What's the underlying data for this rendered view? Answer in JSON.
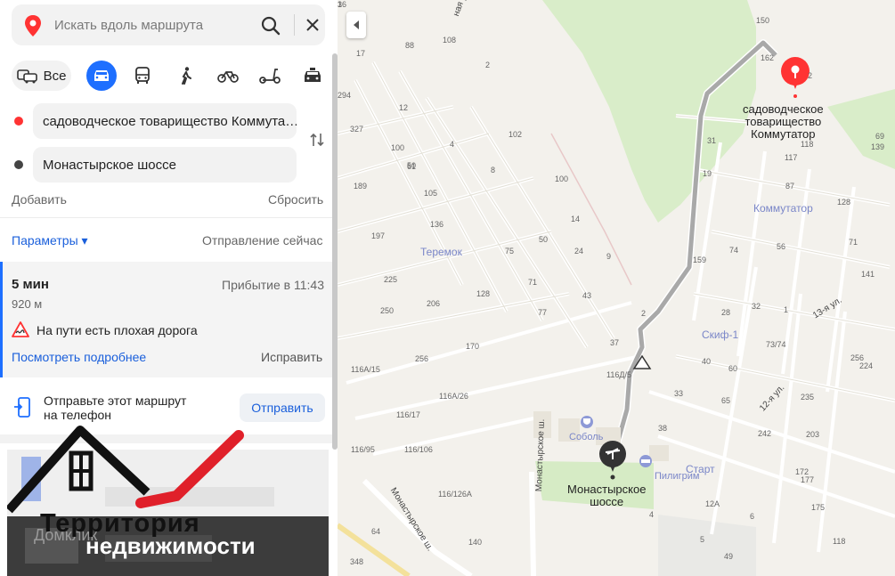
{
  "search": {
    "placeholder": "Искать вдоль маршрута"
  },
  "modes": {
    "all_label": "Все"
  },
  "waypoints": [
    {
      "text": "садоводческое товарищество Коммута…",
      "color": "#ff3333"
    },
    {
      "text": "Монастырское шоссе",
      "color": "#444444"
    }
  ],
  "actions": {
    "add": "Добавить",
    "reset": "Сбросить"
  },
  "params": {
    "label": "Параметры ▾",
    "departure": "Отправление сейчас"
  },
  "route": {
    "time": "5 мин",
    "arrival": "Прибытие в 11:43",
    "distance": "920 м",
    "warning": "На пути есть плохая дорога",
    "details": "Посмотреть подробнее",
    "fix": "Исправить"
  },
  "send": {
    "text_line1": "Отправьте этот маршрут",
    "text_line2": "на телефон",
    "button": "Отправить"
  },
  "watermark": {
    "line1": "Территория",
    "line2": "недвижимости",
    "brand": "Домклик"
  },
  "map": {
    "dest_label_1": "садоводческое",
    "dest_label_2": "товарищество",
    "dest_label_3": "Коммутатор",
    "start_label_1": "Монастырское",
    "start_label_2": "шоссе",
    "districts": [
      "Теремок",
      "Коммутатор",
      "Скиф-1",
      "Старт"
    ],
    "pois": [
      "Соболь",
      "Пилигрим"
    ],
    "streets": [
      "Монастырское ш.",
      "Монастырское ш.",
      "13-я ул.",
      "12-я ул.",
      "ная ул."
    ],
    "numbers": [
      "108",
      "88",
      "17",
      "2",
      "294",
      "12",
      "102",
      "327",
      "100",
      "4",
      "8",
      "50",
      "189",
      "61",
      "100",
      "105",
      "14",
      "136",
      "197",
      "50",
      "24",
      "9",
      "75",
      "225",
      "128",
      "71",
      "43",
      "206",
      "250",
      "77",
      "2",
      "170",
      "37",
      "256",
      "116А/15",
      "116Д/5",
      "116А/26",
      "116/17",
      "116/95",
      "116/106",
      "116/126А",
      "140",
      "348",
      "64",
      "150",
      "162",
      "2",
      "31",
      "118",
      "117",
      "19",
      "87",
      "128",
      "71",
      "56",
      "74",
      "159",
      "141",
      "28",
      "32",
      "1",
      "73/74",
      "256",
      "224",
      "40",
      "60",
      "65",
      "235",
      "242",
      "203",
      "172",
      "177",
      "175",
      "118",
      "12А",
      "6",
      "33",
      "38",
      "4",
      "5",
      "49",
      "69",
      "139",
      "36",
      "1"
    ]
  }
}
